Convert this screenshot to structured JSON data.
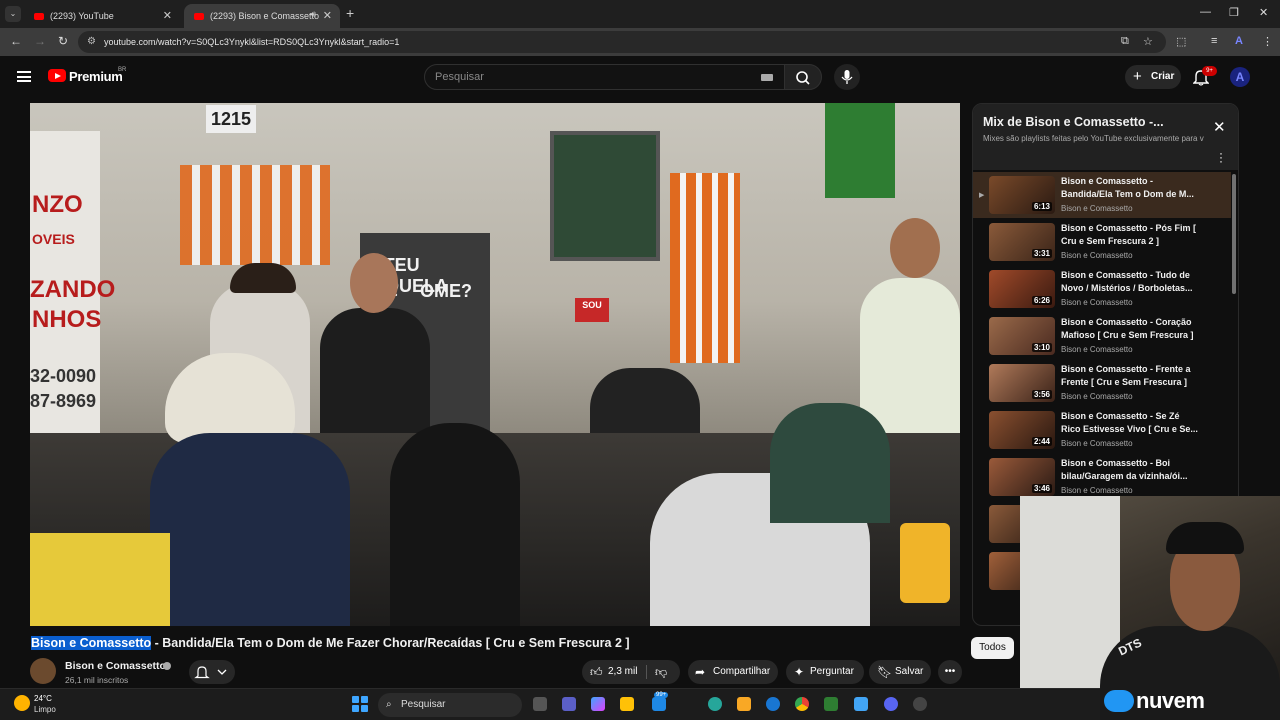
{
  "browser": {
    "tabs": [
      {
        "title": "(2293) YouTube"
      },
      {
        "title": "(2293) Bison e Comassetto"
      }
    ],
    "url": "youtube.com/watch?v=S0QLc3Ynykl&list=RDS0QLc3Ynykl&start_radio=1"
  },
  "header": {
    "brand": "Premium",
    "country": "BR",
    "search_placeholder": "Pesquisar",
    "create_label": "Criar",
    "notifications_badge": "9+",
    "avatar_letter": "A"
  },
  "video": {
    "title_highlight": "Bison e Comassetto",
    "title_rest": " - Bandida/Ela Tem o Dom de Me Fazer Chorar/Recaídas [ Cru e Sem Frescura 2 ]",
    "scene_text": {
      "door_number": "1215",
      "banner_1": "ATEU AQUELA",
      "banner_2": "OME?",
      "sign_left_1": "NZO",
      "sign_left_2": "OVEIS",
      "sign_left_3": "ZANDO",
      "sign_left_4": "NHOS",
      "phone_1": "32-0090",
      "phone_2": "87-8969",
      "sou_sign": "SOU"
    },
    "channel": "Bison e Comassetto",
    "subscribers": "26,1 mil inscritos",
    "likes": "2,3 mil",
    "share_label": "Compartilhar",
    "ask_label": "Perguntar",
    "save_label": "Salvar"
  },
  "playlist": {
    "title": "Mix de Bison e Comassetto -...",
    "subtitle": "Mixes são playlists feitas pelo YouTube exclusivamente para v",
    "items": [
      {
        "title": "Bison e Comassetto - Bandida/Ela Tem o Dom de M...",
        "channel": "Bison e Comassetto",
        "duration": "6:13"
      },
      {
        "title": "Bison e Comassetto - Pós Fim [ Cru e Sem Frescura 2 ]",
        "channel": "Bison e Comassetto",
        "duration": "3:31"
      },
      {
        "title": "Bison e Comassetto - Tudo de Novo / Mistérios / Borboletas...",
        "channel": "Bison e Comassetto",
        "duration": "6:26"
      },
      {
        "title": "Bison e Comassetto - Coração Mafioso [ Cru e Sem Frescura ]",
        "channel": "Bison e Comassetto",
        "duration": "3:10"
      },
      {
        "title": "Bison e Comassetto - Frente a Frente [ Cru e Sem Frescura ]",
        "channel": "Bison e Comassetto",
        "duration": "3:56"
      },
      {
        "title": "Bison e Comassetto - Se Zé Rico Estivesse Vivo [ Cru e Se...",
        "channel": "Bison e Comassetto",
        "duration": "2:44"
      },
      {
        "title": "Bison e Comassetto - Boi bilau/Garagem da vizinha/ói...",
        "channel": "Bison e Comassetto",
        "duration": "3:46"
      }
    ]
  },
  "chips": {
    "todos": "Todos"
  },
  "overlay": {
    "logo_text": "nuvem",
    "shirt_text": "DTS"
  },
  "taskbar": {
    "temperature": "24°C",
    "condition": "Limpo",
    "search_label": "Pesquisar",
    "badge": "99+"
  }
}
